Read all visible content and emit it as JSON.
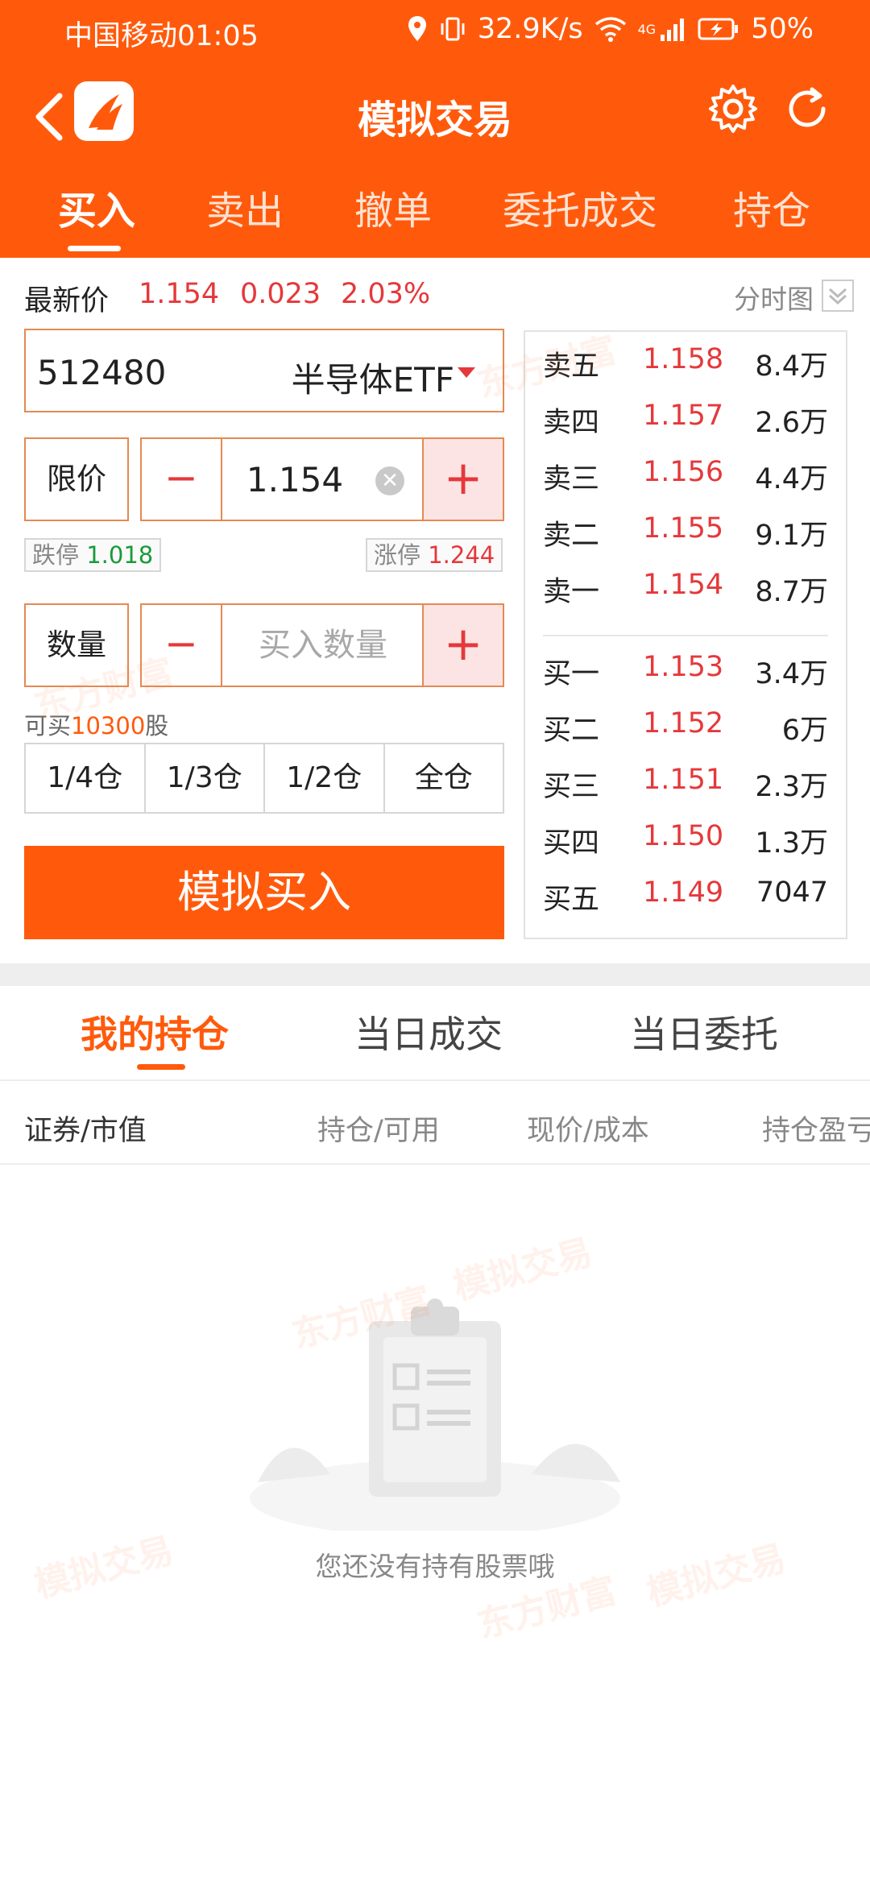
{
  "status_bar": {
    "carrier_time": "中国移动01:05",
    "net_speed": "32.9K/s",
    "network": "4G",
    "battery": "50%"
  },
  "header": {
    "title": "模拟交易",
    "tabs": [
      "买入",
      "卖出",
      "撤单",
      "委托成交",
      "持仓"
    ],
    "active_tab": 0
  },
  "quote": {
    "label": "最新价",
    "price": "1.154",
    "change": "0.023",
    "change_pct": "2.03%",
    "chart_link": "分时图"
  },
  "order_form": {
    "stock_code": "512480",
    "stock_name": "半导体ETF",
    "price_type": "限价",
    "price": "1.154",
    "limit_down_label": "跌停",
    "limit_down": "1.018",
    "limit_up_label": "涨停",
    "limit_up": "1.244",
    "qty_label": "数量",
    "qty_placeholder": "买入数量",
    "minus": "−",
    "plus": "+",
    "clear": "✕",
    "avail_prefix": "可买",
    "avail_num": "10300",
    "avail_suffix": "股",
    "position_buttons": [
      "1/4仓",
      "1/3仓",
      "1/2仓",
      "全仓"
    ],
    "submit_label": "模拟买入"
  },
  "order_book": {
    "asks": [
      {
        "name": "卖五",
        "price": "1.158",
        "vol": "8.4万"
      },
      {
        "name": "卖四",
        "price": "1.157",
        "vol": "2.6万"
      },
      {
        "name": "卖三",
        "price": "1.156",
        "vol": "4.4万"
      },
      {
        "name": "卖二",
        "price": "1.155",
        "vol": "9.1万"
      },
      {
        "name": "卖一",
        "price": "1.154",
        "vol": "8.7万"
      }
    ],
    "bids": [
      {
        "name": "买一",
        "price": "1.153",
        "vol": "3.4万"
      },
      {
        "name": "买二",
        "price": "1.152",
        "vol": "6万"
      },
      {
        "name": "买三",
        "price": "1.151",
        "vol": "2.3万"
      },
      {
        "name": "买四",
        "price": "1.150",
        "vol": "1.3万"
      },
      {
        "name": "买五",
        "price": "1.149",
        "vol": "7047"
      }
    ]
  },
  "bottom": {
    "tabs": [
      "我的持仓",
      "当日成交",
      "当日委托"
    ],
    "active_tab": 0,
    "columns": [
      "证券/市值",
      "持仓/可用",
      "现价/成本",
      "持仓盈亏"
    ],
    "empty_text": "您还没有持有股票哦"
  },
  "watermarks": [
    "东方财富",
    "模拟交易"
  ],
  "colors": {
    "brand": "#ff5a0c",
    "up_red": "#e5383b",
    "down_green": "#1a9a3a"
  }
}
